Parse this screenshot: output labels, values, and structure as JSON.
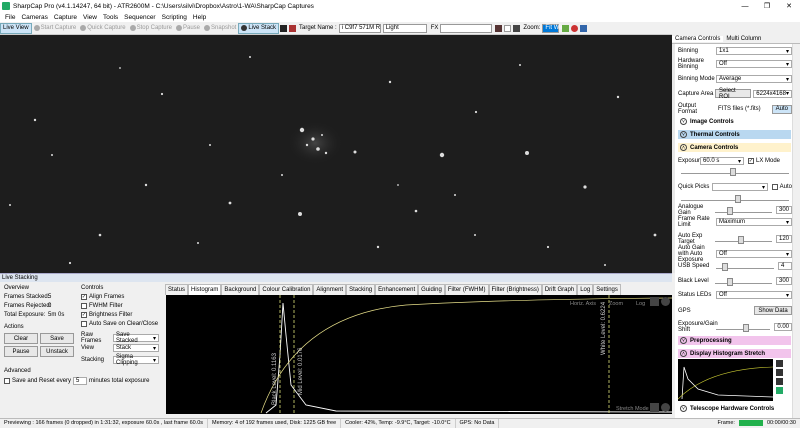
{
  "window": {
    "title": "SharpCap Pro (v4.1.14247, 64 bit) - ATR2600M - C:\\Users\\silvi\\Dropbox\\Astro\\1-WA\\SharpCap Captures"
  },
  "menu": [
    "File",
    "Cameras",
    "Capture",
    "View",
    "Tools",
    "Sequencer",
    "Scripting",
    "Help"
  ],
  "toolbar": {
    "live_view": "Live View",
    "start_capture": "Start Capture",
    "quick_capture": "Quick Capture",
    "stop_capture": "Stop Capture",
    "pause": "Pause",
    "snapshot": "Snapshot",
    "live_stack": "Live Stack",
    "target_label": "Target Name :",
    "target_value": "i C9f7 571M R",
    "filter_value": "Light",
    "fx_label": "FX",
    "zoom_label": "Zoom:",
    "zoom_value": "Fit Win"
  },
  "right_panel": {
    "tab_camera": "Camera Controls",
    "tab_multi": "Multi Column",
    "binning_label": "Binning",
    "binning_value": "1x1",
    "hw_binning_label": "Hardware Binning",
    "hw_binning_value": "Off",
    "binning_mode_label": "Binning Mode",
    "binning_mode_value": "Average",
    "capture_area_label": "Capture Area",
    "select_roi": "Select ROI",
    "capture_area_value": "6224x4168",
    "output_format_label": "Output Format",
    "output_format_value": "FITS files (*.fits)",
    "auto_label": "Auto",
    "image_controls": "Image Controls",
    "thermal_controls": "Thermal Controls",
    "camera_controls": "Camera Controls",
    "exposure_label": "Exposure",
    "exposure_value": "60.0 s",
    "lx_mode": "LX Mode",
    "quick_picks": "Quick Picks",
    "auto2": "Auto",
    "analogue_gain_label": "Analogue Gain",
    "analogue_gain_value": "300",
    "frame_rate_label": "Frame Rate Limit",
    "frame_rate_value": "Maximum",
    "auto_exp_label": "Auto Exp Target",
    "auto_exp_value": "120",
    "auto_gain_label": "Auto Gain with Auto Exposure",
    "auto_gain_value": "Off",
    "usb_speed_label": "USB Speed",
    "usb_speed_value": "4",
    "black_level_label": "Black Level",
    "black_level_value": "300",
    "status_leds_label": "Status LEDs",
    "status_leds_value": "Off",
    "gps_label": "GPS",
    "show_data": "Show Data",
    "exposure_shift_label": "Exposure/Gain Shift",
    "exposure_shift_value": "0.00",
    "preprocessing": "Preprocessing",
    "display_histogram": "Display Histogram Stretch",
    "telescope": "Telescope Hardware Controls"
  },
  "live_stacking": {
    "header": "Live Stacking",
    "overview": "Overview",
    "frames_stacked_label": "Frames Stacked:",
    "frames_stacked": "5",
    "frames_rejected_label": "Frames Rejected:",
    "frames_rejected": "0",
    "total_exposure_label": "Total Exposure:",
    "total_exposure": "5m 0s",
    "actions": "Actions",
    "clear": "Clear",
    "save": "Save",
    "pause": "Pause",
    "unstack": "Unstack",
    "advanced": "Advanced",
    "save_reset": "Save and Reset every",
    "save_reset_val": "5",
    "minutes": "minutes total exposure",
    "controls": "Controls",
    "align_frames": "Align Frames",
    "fwhm_filter": "FWHM Filter",
    "brightness_filter": "Brightness Filter",
    "auto_save": "Auto Save on Clear/Close",
    "raw_frames_label": "Raw Frames",
    "raw_frames_value": "Save Stacked",
    "view_label": "View",
    "view_value": "Stack",
    "stacking_label": "Stacking",
    "stacking_value": "Sigma Clipping"
  },
  "tabs": [
    "Status",
    "Histogram",
    "Background",
    "Colour Calibration",
    "Alignment",
    "Stacking",
    "Enhancement",
    "Guiding",
    "Filter (FWHM)",
    "Filter (Brightness)",
    "Drift Graph",
    "Log",
    "Settings"
  ],
  "histogram": {
    "horiz_axis": "Horiz. Axis",
    "zoom": "Zoom",
    "log": "Log",
    "stretch_mode": "Stretch Mode",
    "black_level": "Black Level: 0.1163",
    "mid_level": "Mid Level: 0.0176",
    "white_level": "White Level: 0.6224"
  },
  "statusbar": {
    "preview": "Previewing : 166 frames (0 dropped) in 1:31:32, exposure 60.0s , last frame 60.0s",
    "memory": "Memory: 4 of 192 frames used, Disk: 1225 GB free",
    "cooler": "Cooler: 42%, Temp: -9.9°C, Target: -10.0°C",
    "gps": "GPS: No Data",
    "frame_label": "Frame:",
    "time": "00:00/00:30"
  },
  "colors": {
    "accent": "#0078d7",
    "thermal": "#b9d8f0",
    "camera": "#fff2cc",
    "preprocessing": "#f2c4ec",
    "histogram_bg": "#f2c4ec",
    "frame_bar": "#22b14c"
  }
}
